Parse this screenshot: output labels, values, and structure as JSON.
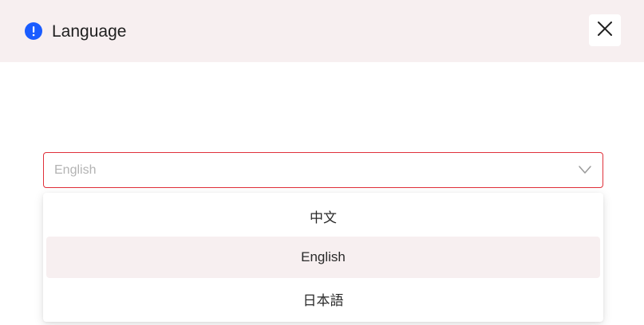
{
  "dialog": {
    "title": "Language",
    "info_icon": "info-icon",
    "close_icon": "close-icon"
  },
  "select": {
    "value": "English",
    "chevron_icon": "chevron-down-icon",
    "border_color": "#e0303a"
  },
  "options": [
    {
      "label": "中文",
      "highlighted": false
    },
    {
      "label": "English",
      "highlighted": true
    },
    {
      "label": "日本語",
      "highlighted": false
    }
  ],
  "colors": {
    "header_bg": "#f7eff0",
    "accent_blue": "#1a5cff",
    "highlight_bg": "#f7eff0"
  }
}
